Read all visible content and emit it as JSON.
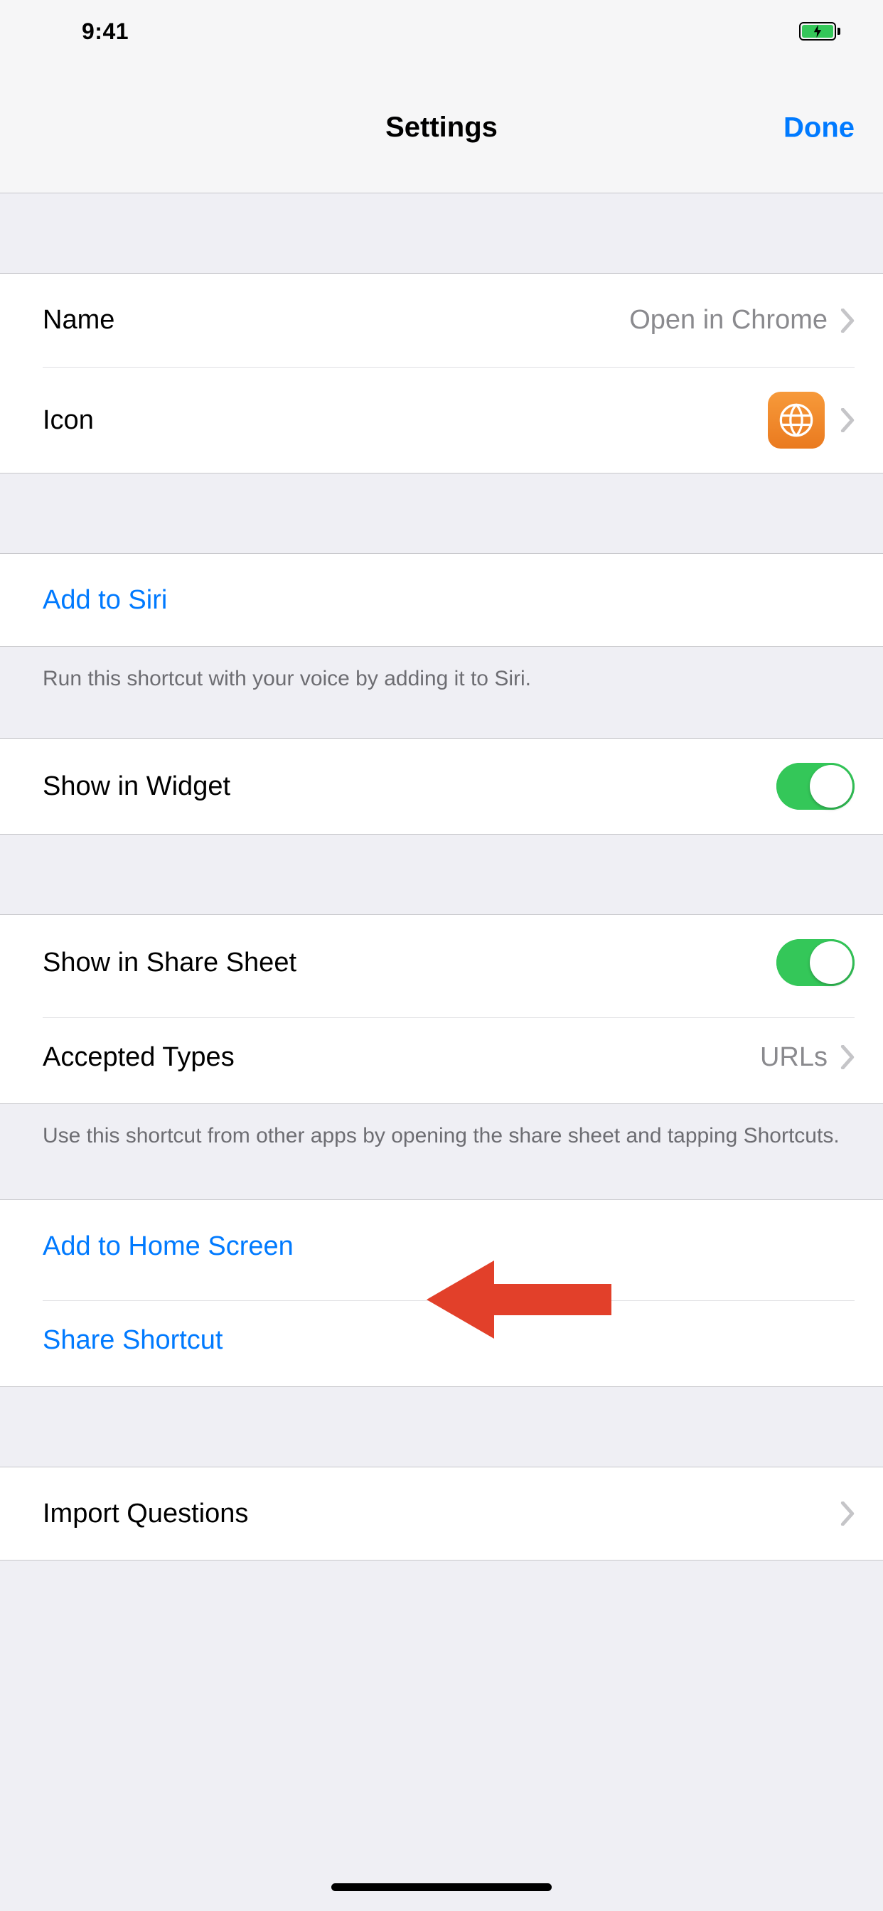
{
  "status": {
    "time": "9:41"
  },
  "nav": {
    "title": "Settings",
    "done": "Done"
  },
  "rows": {
    "name": {
      "label": "Name",
      "value": "Open in Chrome"
    },
    "icon": {
      "label": "Icon"
    },
    "siri": {
      "label": "Add to Siri",
      "footer": "Run this shortcut with your voice by adding it to Siri."
    },
    "widget": {
      "label": "Show in Widget"
    },
    "share": {
      "label": "Show in Share Sheet"
    },
    "types": {
      "label": "Accepted Types",
      "value": "URLs",
      "footer": "Use this shortcut from other apps by opening the share sheet and tapping Shortcuts."
    },
    "home": {
      "label": "Add to Home Screen"
    },
    "shareShortcut": {
      "label": "Share Shortcut"
    },
    "import": {
      "label": "Import Questions"
    }
  }
}
